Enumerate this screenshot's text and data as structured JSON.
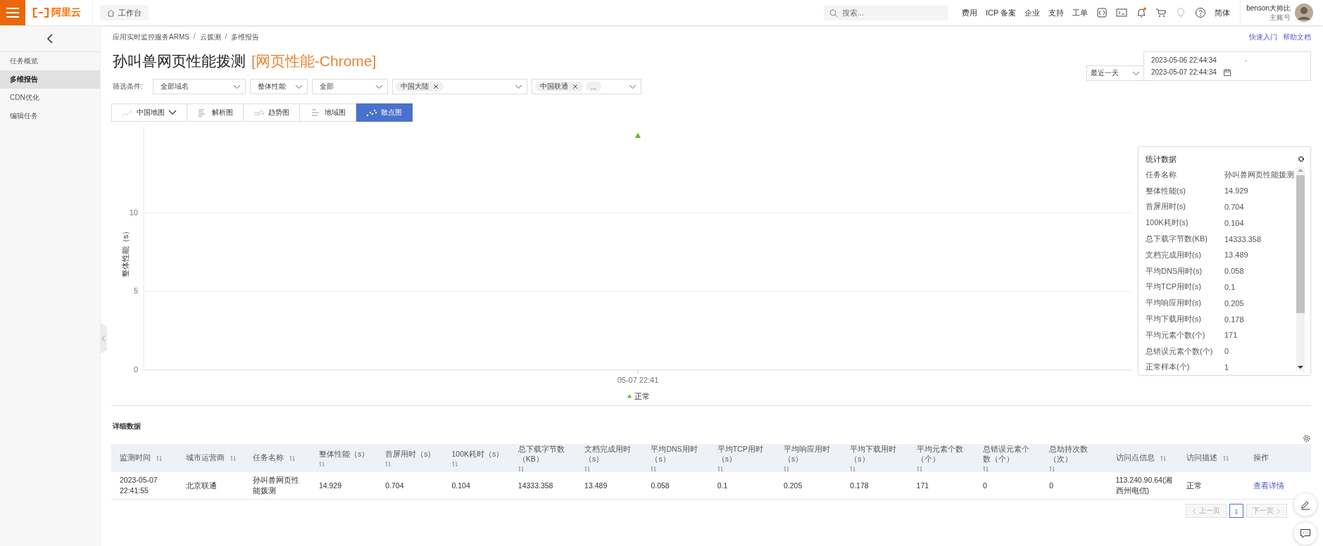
{
  "header": {
    "logo": "阿里云",
    "workbench": "工作台",
    "search": {
      "placeholder": "搜索..."
    },
    "links": [
      "费用",
      "ICP 备案",
      "企业",
      "支持",
      "工单"
    ],
    "language": "简体",
    "user": {
      "name": "benson大帅比",
      "role": "主账号"
    }
  },
  "sidebar": {
    "items": [
      {
        "label": "任务概览",
        "selected": false
      },
      {
        "label": "多维报告",
        "selected": true
      },
      {
        "label": "CDN优化",
        "selected": false
      },
      {
        "label": "编辑任务",
        "selected": false
      }
    ]
  },
  "breadcrumb": {
    "items": [
      "应用实时监控服务ARMS",
      "云拨测",
      "多维报告"
    ],
    "separator": "/"
  },
  "help_links": [
    "快速入门",
    "帮助文档"
  ],
  "title": "孙叫兽网页性能拨测",
  "title_tag": "[网页性能-Chrome]",
  "time_range": {
    "preset": "最近一天",
    "start": "2023-05-06 22:44:34",
    "separator": "-",
    "end": "2023-05-07 22:44:34"
  },
  "filters": {
    "label": "筛选条件:",
    "controls": [
      {
        "kind": "select",
        "value": "全部域名"
      },
      {
        "kind": "select",
        "value": "整体性能"
      },
      {
        "kind": "select",
        "value": "全部"
      },
      {
        "kind": "tags",
        "tags": [
          {
            "label": "中国大陆",
            "closable": true
          }
        ]
      },
      {
        "kind": "tags",
        "tags": [
          {
            "label": "中国联通",
            "closable": true
          },
          {
            "label": "...",
            "closable": false
          }
        ]
      }
    ]
  },
  "chart_tabs": [
    {
      "label": "中国地图",
      "selected": false,
      "dropdown": true
    },
    {
      "label": "解析图",
      "selected": false,
      "dropdown": false
    },
    {
      "label": "趋势图",
      "selected": false,
      "dropdown": false
    },
    {
      "label": "地域图",
      "selected": false,
      "dropdown": false
    },
    {
      "label": "散点图",
      "selected": true,
      "dropdown": false
    }
  ],
  "chart": {
    "chart_data": {
      "type": "scatter",
      "ylabel": "整体性能（s）",
      "x": [
        "05-07 22:41"
      ],
      "yticks": [
        0,
        5,
        10
      ],
      "ylim": [
        0,
        15.5
      ],
      "series": [
        {
          "name": "正常",
          "color": "#52c41a",
          "values": [
            14.929
          ]
        }
      ]
    }
  },
  "stats": {
    "title": "统计数据",
    "rows": [
      {
        "label": "任务名称",
        "value": "孙叫兽网页性能拨测"
      },
      {
        "label": "整体性能(s)",
        "value": "14.929"
      },
      {
        "label": "首屏用时(s)",
        "value": "0.704"
      },
      {
        "label": "100K耗时(s)",
        "value": "0.104"
      },
      {
        "label": "总下载字节数(KB)",
        "value": "14333.358"
      },
      {
        "label": "文档完成用时(s)",
        "value": "13.489"
      },
      {
        "label": "平均DNS用时(s)",
        "value": "0.058"
      },
      {
        "label": "平均TCP用时(s)",
        "value": "0.1"
      },
      {
        "label": "平均响应用时(s)",
        "value": "0.205"
      },
      {
        "label": "平均下载用时(s)",
        "value": "0.178"
      },
      {
        "label": "平均元素个数(个)",
        "value": "171"
      },
      {
        "label": "总错误元素个数(个)",
        "value": "0"
      },
      {
        "label": "正常样本(个)",
        "value": "1"
      }
    ]
  },
  "details": {
    "title": "详细数据",
    "columns": [
      {
        "label": "监测时间",
        "sortable": true
      },
      {
        "label": "城市运营商",
        "sortable": true
      },
      {
        "label": "任务名称",
        "sortable": true
      },
      {
        "label": "整体性能（s）",
        "sortable": true
      },
      {
        "label": "首屏用时（s）",
        "sortable": true
      },
      {
        "label": "100K耗时（s）",
        "sortable": true
      },
      {
        "label": "总下载字节数（KB）",
        "sortable": true
      },
      {
        "label": "文档完成用时（s）",
        "sortable": true
      },
      {
        "label": "平均DNS用时（s）",
        "sortable": true
      },
      {
        "label": "平均TCP用时（s）",
        "sortable": true
      },
      {
        "label": "平均响应用时（s）",
        "sortable": true
      },
      {
        "label": "平均下载用时（s）",
        "sortable": true
      },
      {
        "label": "平均元素个数（个）",
        "sortable": true
      },
      {
        "label": "总错误元素个数（个）",
        "sortable": true
      },
      {
        "label": "总劫持次数（次）",
        "sortable": true
      },
      {
        "label": "访问点信息",
        "sortable": true
      },
      {
        "label": "访问描述",
        "sortable": true
      },
      {
        "label": "操作",
        "sortable": false
      }
    ],
    "rows": [
      {
        "cells": [
          "2023-05-07 22:41:55",
          "北京联通",
          "孙叫兽网页性能拨测",
          "14.929",
          "0.704",
          "0.104",
          "14333.358",
          "13.489",
          "0.058",
          "0.1",
          "0.205",
          "0.178",
          "171",
          "0",
          "0",
          "113.240.90.64(湘西州电信)",
          "正常"
        ],
        "action": "查看详情"
      }
    ]
  },
  "pagination": {
    "prev": "上一页",
    "pages": [
      {
        "label": "1",
        "selected": true
      }
    ],
    "next": "下一页"
  }
}
